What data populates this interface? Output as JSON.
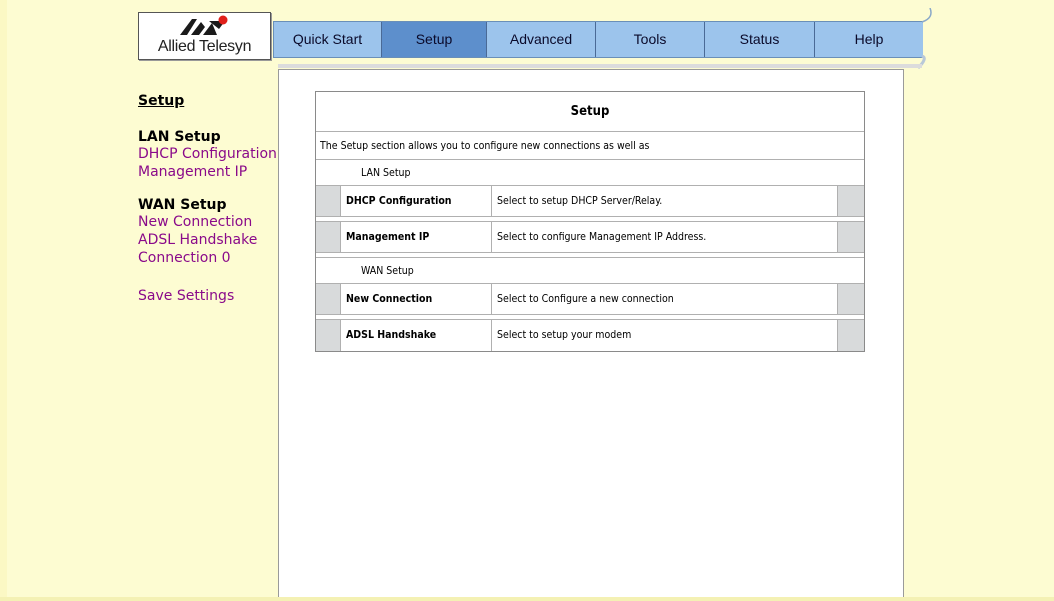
{
  "brand": {
    "logo_text": "Allied Telesyn",
    "logo_color": "#1a1a1a",
    "logo_accent": "#e0201a"
  },
  "nav": {
    "tabs": [
      {
        "label": "Quick Start",
        "active": false
      },
      {
        "label": "Setup",
        "active": true
      },
      {
        "label": "Advanced",
        "active": false
      },
      {
        "label": "Tools",
        "active": false
      },
      {
        "label": "Status",
        "active": false
      },
      {
        "label": "Help",
        "active": false
      }
    ]
  },
  "sidebar": {
    "title": "Setup",
    "lan": {
      "heading": "LAN Setup",
      "links": [
        "DHCP Configuration",
        "Management IP"
      ]
    },
    "wan": {
      "heading": "WAN Setup",
      "links": [
        "New Connection",
        "ADSL Handshake",
        "Connection 0"
      ]
    },
    "save": "Save Settings"
  },
  "main": {
    "title": "Setup",
    "description": "The Setup section allows you to configure new connections as well as",
    "lan_group": "LAN Setup",
    "wan_group": "WAN Setup",
    "lan_items": [
      {
        "name": "DHCP Configuration",
        "desc": "Select to setup DHCP Server/Relay."
      },
      {
        "name": "Management IP",
        "desc": "Select to configure Management IP Address."
      }
    ],
    "wan_items": [
      {
        "name": "New Connection",
        "desc": "Select to Configure a new connection"
      },
      {
        "name": "ADSL Handshake",
        "desc": "Select to setup your modem"
      }
    ]
  },
  "colors": {
    "page_bg": "#fdfcd2",
    "tab_bg": "#9cc4ec",
    "tab_active": "#5d8fcc",
    "link": "#8a0a8a"
  }
}
